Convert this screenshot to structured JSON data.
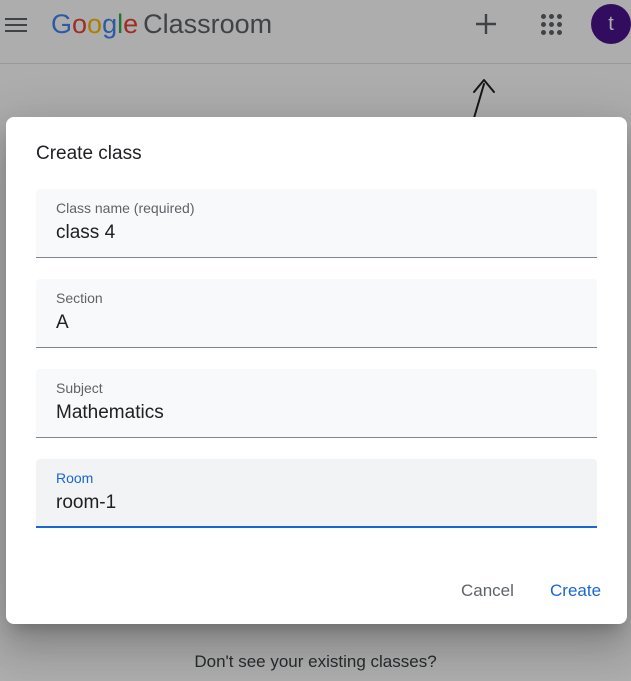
{
  "header": {
    "brand_letters": [
      "G",
      "o",
      "o",
      "g",
      "l",
      "e"
    ],
    "product_name": "Classroom",
    "avatar_initial": "t"
  },
  "page": {
    "help_text": "Don't see your existing classes?"
  },
  "dialog": {
    "title": "Create class",
    "fields": [
      {
        "label": "Class name (required)",
        "value": "class 4"
      },
      {
        "label": "Section",
        "value": "A"
      },
      {
        "label": "Subject",
        "value": "Mathematics"
      },
      {
        "label": "Room",
        "value": "room-1",
        "focused": true
      }
    ],
    "cancel_label": "Cancel",
    "create_label": "Create"
  },
  "colors": {
    "accent": "#1967d2",
    "avatar_bg": "#4a148c",
    "scrim": "rgba(0,0,0,0.32)"
  },
  "icons": {
    "menu": "menu-icon",
    "add": "plus-icon",
    "apps": "apps-grid-icon",
    "annotation": "hand-drawn-arrow-icon"
  }
}
